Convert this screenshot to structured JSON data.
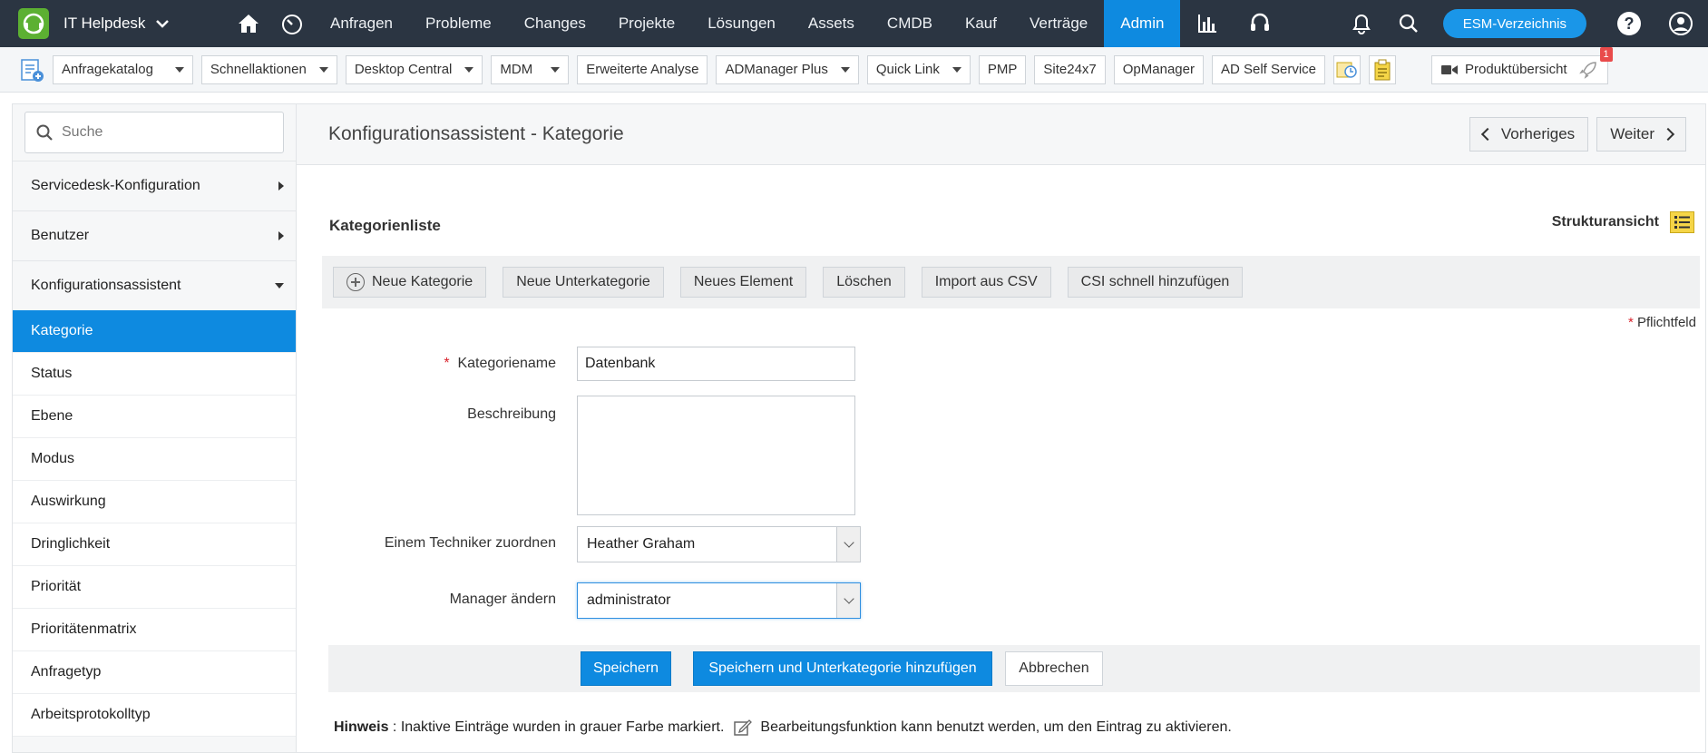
{
  "topnav": {
    "app_title": "IT Helpdesk",
    "items": [
      {
        "label": "Anfragen"
      },
      {
        "label": "Probleme"
      },
      {
        "label": "Changes"
      },
      {
        "label": "Projekte"
      },
      {
        "label": "Lösungen"
      },
      {
        "label": "Assets"
      },
      {
        "label": "CMDB"
      },
      {
        "label": "Kauf"
      },
      {
        "label": "Verträge"
      },
      {
        "label": "Admin"
      }
    ],
    "active": "Admin",
    "esm_button": "ESM-Verzeichnis",
    "help": "?",
    "accent": "#0e8ae0",
    "bar_color": "#2b3542"
  },
  "toolbar": {
    "dropdowns": [
      {
        "label": "Anfragekatalog"
      },
      {
        "label": "Schnellaktionen"
      },
      {
        "label": "Desktop Central"
      },
      {
        "label": "MDM"
      }
    ],
    "plain": [
      {
        "label": "Erweiterte Analyse"
      }
    ],
    "dropdowns2": [
      {
        "label": "ADManager Plus"
      },
      {
        "label": "Quick Link"
      }
    ],
    "plain2": [
      {
        "label": "PMP"
      },
      {
        "label": "Site24x7"
      },
      {
        "label": "OpManager"
      },
      {
        "label": "AD Self Service"
      }
    ],
    "product_overview": "Produktübersicht",
    "badge": "1"
  },
  "sidebar": {
    "search_placeholder": "Suche",
    "sections": [
      {
        "label": "Servicedesk-Konfiguration"
      },
      {
        "label": "Benutzer"
      },
      {
        "label": "Konfigurationsassistent"
      }
    ],
    "items": [
      {
        "label": "Kategorie"
      },
      {
        "label": "Status"
      },
      {
        "label": "Ebene"
      },
      {
        "label": "Modus"
      },
      {
        "label": "Auswirkung"
      },
      {
        "label": "Dringlichkeit"
      },
      {
        "label": "Priorität"
      },
      {
        "label": "Prioritätenmatrix"
      },
      {
        "label": "Anfragetyp"
      },
      {
        "label": "Arbeitsprotokolltyp"
      }
    ],
    "active": "Kategorie"
  },
  "main": {
    "title": "Konfigurationsassistent - Kategorie",
    "prev": "Vorheriges",
    "next": "Weiter",
    "list_header": "Kategorienliste",
    "structure_view": "Strukturansicht",
    "actions": [
      {
        "label": "Neue Kategorie"
      },
      {
        "label": "Neue Unterkategorie"
      },
      {
        "label": "Neues Element"
      },
      {
        "label": "Löschen"
      },
      {
        "label": "Import aus CSV"
      },
      {
        "label": "CSI schnell hinzufügen"
      }
    ],
    "required_star": "*",
    "required_label": "Pflichtfeld",
    "form": {
      "name_label": "Kategoriename",
      "name_value": "Datenbank",
      "desc_label": "Beschreibung",
      "desc_value": "",
      "tech_label": "Einem Techniker zuordnen",
      "tech_value": "Heather Graham",
      "manager_label": "Manager ändern",
      "manager_value": "administrator"
    },
    "buttons": {
      "save": "Speichern",
      "save_sub": "Speichern und Unterkategorie hinzufügen",
      "cancel": "Abbrechen"
    },
    "note": {
      "bold": "Hinweis",
      "sep": " : ",
      "text1": "Inaktive Einträge wurden in grauer Farbe markiert.",
      "text2": "Bearbeitungsfunktion kann benutzt werden, um den Eintrag zu aktivieren."
    }
  }
}
